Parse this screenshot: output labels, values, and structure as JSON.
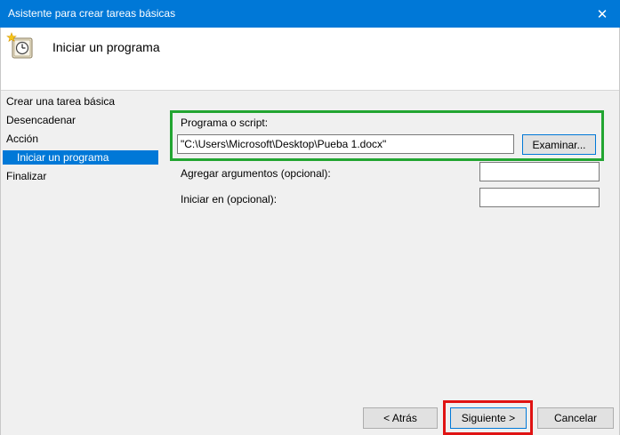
{
  "window": {
    "title": "Asistente para crear tareas básicas",
    "close_glyph": "✕"
  },
  "header": {
    "title": "Iniciar un programa",
    "icon": "task-scheduler-icon"
  },
  "steps": [
    {
      "label": "Crear una tarea básica",
      "active": false
    },
    {
      "label": "Desencadenar",
      "active": false
    },
    {
      "label": "Acción",
      "active": false
    },
    {
      "label": "Iniciar un programa",
      "active": true
    },
    {
      "label": "Finalizar",
      "active": false
    }
  ],
  "form": {
    "program_label": "Programa o script:",
    "program_value": "\"C:\\Users\\Microsoft\\Desktop\\Pueba 1.docx\"",
    "browse_label": "Examinar...",
    "args_label": "Agregar argumentos (opcional):",
    "args_value": "",
    "start_in_label": "Iniciar en (opcional):",
    "start_in_value": ""
  },
  "buttons": {
    "back": "< Atrás",
    "next": "Siguiente >",
    "cancel": "Cancelar"
  },
  "colors": {
    "title_bar": "#0078d7",
    "selection": "#0078d7",
    "highlight_green": "#22a531",
    "highlight_red": "#e01313"
  }
}
